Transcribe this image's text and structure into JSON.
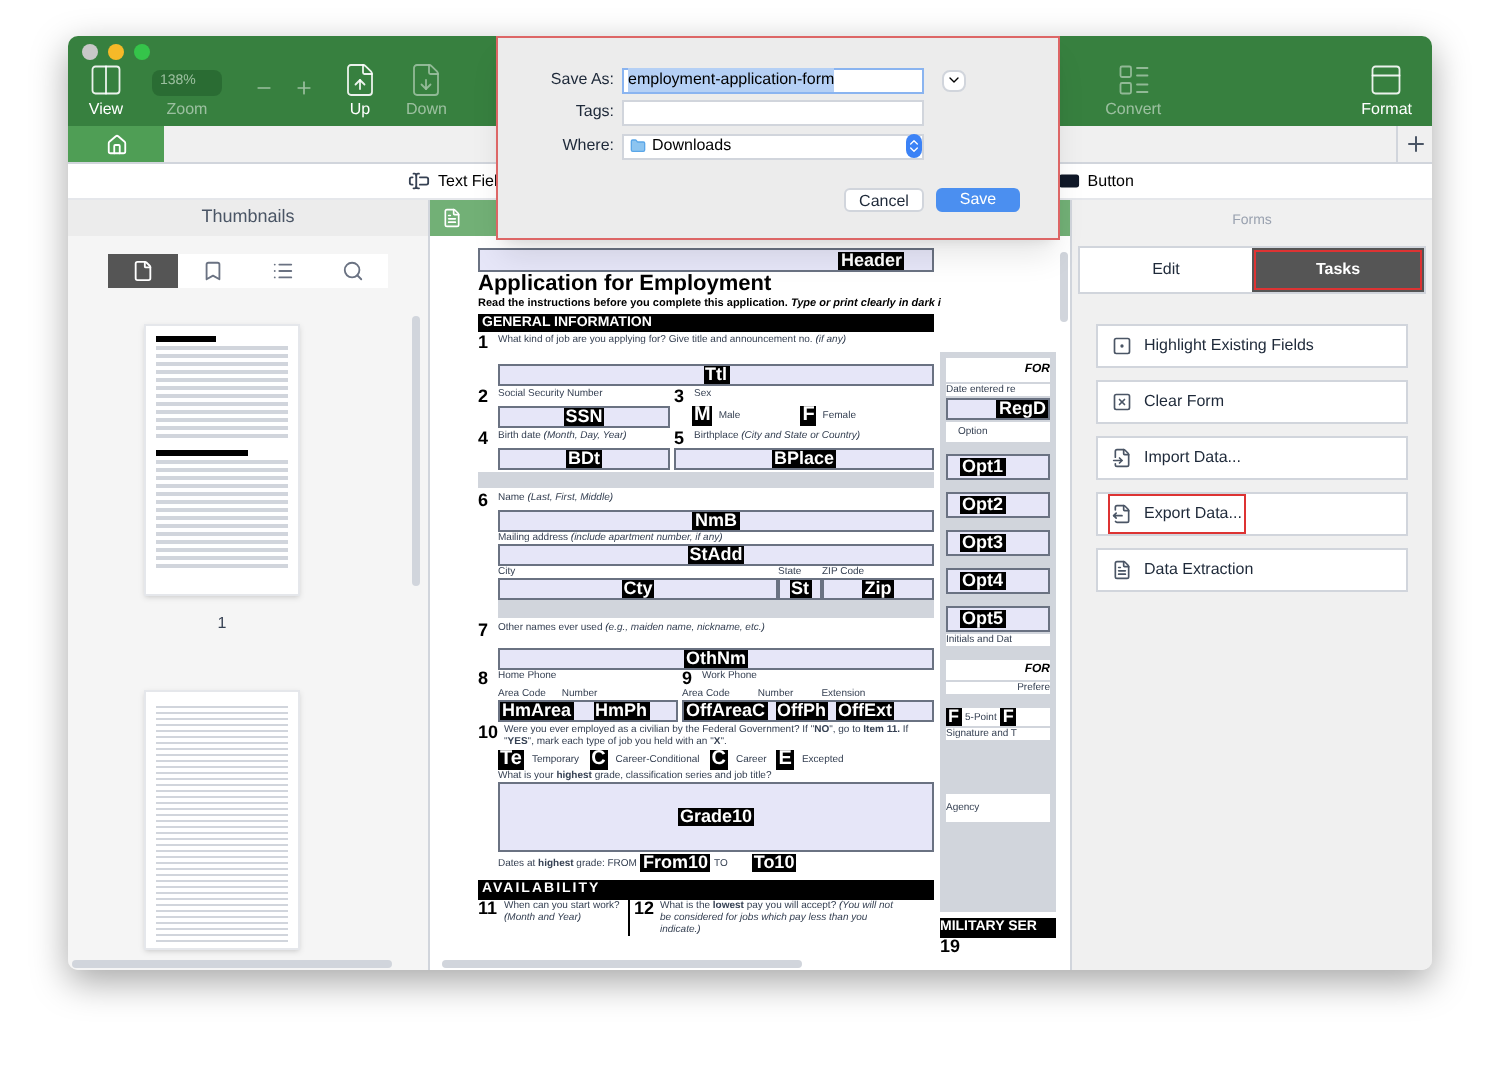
{
  "toolbar": {
    "items": [
      {
        "kind": "view",
        "label": "View",
        "disabled": false
      },
      {
        "kind": "zoom",
        "label": "Zoom",
        "value": "138%",
        "disabled": true
      },
      {
        "kind": "up",
        "label": "Up",
        "disabled": false
      },
      {
        "kind": "down",
        "label": "Down",
        "disabled": true
      }
    ],
    "right_items": [
      {
        "kind": "convert",
        "label": "Convert",
        "disabled": true
      },
      {
        "kind": "format",
        "label": "Format",
        "disabled": false
      }
    ]
  },
  "tab_bar": {
    "tabs": [
      {
        "kind": "home",
        "selected": true
      }
    ]
  },
  "form_toolbar": [
    {
      "kind": "text_field",
      "label": "Text Fiel"
    },
    {
      "kind": "button",
      "label": "Button"
    }
  ],
  "thumbnails": {
    "title": "Thumbnails",
    "tabs": [
      {
        "kind": "pages",
        "selected": true
      },
      {
        "kind": "bookmarks",
        "selected": false
      },
      {
        "kind": "list",
        "selected": false
      },
      {
        "kind": "search",
        "selected": false
      }
    ],
    "pages": [
      {
        "kind": "form",
        "label": "1"
      },
      {
        "kind": "lined"
      }
    ]
  },
  "document": {
    "header_tag": "Header",
    "title": "Application for Employment",
    "instructions": "Read the instructions before you complete this application.  *Type or print clearly in dark i*",
    "general_information": "GENERAL INFORMATION",
    "q1": {
      "number": "1",
      "label": "What kind of job are you applying for?  Give title and announcement no.  *(if any)*",
      "tag": "Ttl"
    },
    "q2": {
      "number": "2",
      "label": "Social Security Number",
      "tag": "SSN"
    },
    "q3": {
      "number": "3",
      "label": "Sex",
      "options": [
        {
          "tag": "M",
          "label": "Male"
        },
        {
          "tag": "F",
          "label": "Female"
        }
      ]
    },
    "q4": {
      "number": "4",
      "label": "Birth date *(Month, Day, Year)*",
      "tag": "BDt"
    },
    "q5": {
      "number": "5",
      "label": "Birthplace *(City and State or Country)*",
      "tag": "BPlace"
    },
    "q6": {
      "number": "6",
      "label": "Name *(Last, First, Middle)*",
      "tag": "NmB",
      "address_label": "Mailing address *(include apartment number, if any)*",
      "address_tag": "StAdd",
      "city_label": "City",
      "city_tag": "Cty",
      "state_label": "State",
      "state_tag": "St",
      "zip_label": "ZIP Code",
      "zip_tag": "Zip"
    },
    "q7": {
      "number": "7",
      "label": "Other names ever used *(e.g., maiden name, nickname, etc.)*",
      "tag": "OthNm"
    },
    "q8": {
      "number": "8",
      "label": "Home Phone",
      "area_label": "Area Code",
      "number_label": "Number",
      "tags": [
        "HmArea",
        "HmPh"
      ]
    },
    "q9": {
      "number": "9",
      "label": "Work Phone",
      "area_label": "Area Code",
      "number_label": "Number",
      "extension_label": "Extension",
      "tags": [
        "OffAreaC",
        "OffPh",
        "OffExt"
      ]
    },
    "q10": {
      "number": "10",
      "label": "Were you ever employed as a civilian by the Federal Government?  If \"**NO**\", go to **Item 11.**  If \"**YES**\", mark each type of job you held with an \"**X**\".",
      "options": [
        {
          "tag": "Te",
          "label": "Temporary"
        },
        {
          "tag": "C",
          "label": "Career-Conditional"
        },
        {
          "tag": "C",
          "label": "Career"
        },
        {
          "tag": "E",
          "label": "Excepted"
        }
      ],
      "grade_label": "What is your **highest** grade, classification series and job title?",
      "grade_tag": "Grade10",
      "dates_label": "Dates at **highest** grade:  FROM",
      "from_tag": "From10",
      "to_label": "TO",
      "to_tag": "To10"
    },
    "availability": "AVAILABILITY",
    "q11": {
      "number": "11",
      "label": "When can you start work? *(Month and Year)*"
    },
    "q12": {
      "number": "12",
      "label": "What is the **lowest** pay you will accept? *(You will not be considered for jobs which pay less than you indicate.)*"
    },
    "side": {
      "heading": "FOR",
      "date_label": "Date entered re",
      "date_tag": "RegD",
      "option_label": "Option",
      "options": [
        "Opt1",
        "Opt2",
        "Opt3",
        "Opt4",
        "Opt5"
      ],
      "initials_label": "Initials and Dat",
      "heading2": "FOR",
      "preference_label": "Prefere",
      "point_tag": "F",
      "point_label": "5-Point",
      "point_tag2": "F",
      "signature_label": "Signature and T",
      "agency_label": "Agency",
      "military": "MILITARY SER",
      "q19_number": "19"
    }
  },
  "forms_panel": {
    "title": "Forms",
    "tabs": [
      {
        "label": "Edit",
        "selected": false,
        "outlined": false
      },
      {
        "label": "Tasks",
        "selected": true,
        "outlined": true
      }
    ],
    "tasks": [
      {
        "kind": "highlight",
        "label": "Highlight Existing Fields",
        "outlined": false
      },
      {
        "kind": "clear",
        "label": "Clear Form",
        "outlined": false
      },
      {
        "kind": "import",
        "label": "Import Data...",
        "outlined": false
      },
      {
        "kind": "export",
        "label": "Export Data...",
        "outlined": true
      },
      {
        "kind": "extract",
        "label": "Data Extraction",
        "outlined": false
      }
    ]
  },
  "save_dialog": {
    "outlined": true,
    "save_as_label": "Save As:",
    "file_name": "employment-application-form",
    "tags_label": "Tags:",
    "where_label": "Where:",
    "location": "Downloads",
    "buttons": [
      {
        "kind": "cancel",
        "label": "Cancel"
      },
      {
        "kind": "default",
        "label": "Save"
      }
    ]
  }
}
